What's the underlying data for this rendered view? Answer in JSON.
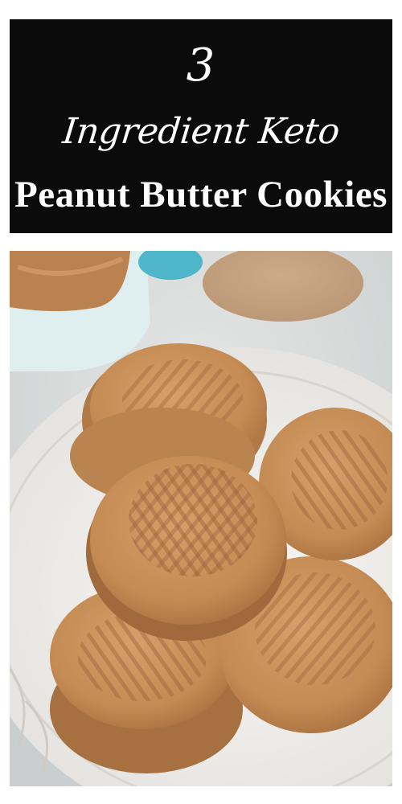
{
  "banner": {
    "line1": "3",
    "line2": "Ingredient Keto",
    "line3": "Peanut Butter Cookies"
  },
  "photo": {
    "subject": "cookies-photo",
    "colors": {
      "banner_bg": "#0b0b0b",
      "cookie": "#c9905a",
      "cookie_dark": "#a8703f",
      "plate": "#f1f0ee",
      "background": "#d9dcdc"
    }
  }
}
